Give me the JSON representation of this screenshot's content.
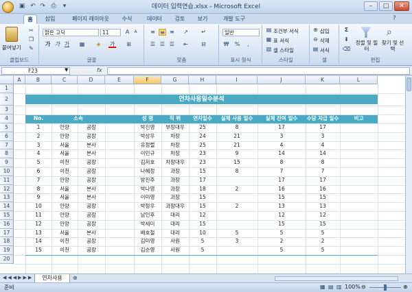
{
  "window": {
    "title": "데이터 입력연습.xlsx - Microsoft Excel"
  },
  "tabs": [
    "홈",
    "삽입",
    "페이지 레이아웃",
    "수식",
    "데이터",
    "검토",
    "보기",
    "개발 도구"
  ],
  "ribbon": {
    "clipboard": {
      "label": "클립보드",
      "paste": "붙여넣기"
    },
    "font": {
      "label": "글꼴",
      "name": "맑은 고딕",
      "size": "11"
    },
    "alignment": {
      "label": "맞춤"
    },
    "number": {
      "label": "표시 형식",
      "format": "일반"
    },
    "styles": {
      "label": "스타일",
      "conditional": "조건부 서식",
      "table": "표 서식",
      "cell": "셀 스타일"
    },
    "cells": {
      "label": "셀",
      "insert": "삽입",
      "delete": "삭제",
      "format": "서식"
    },
    "editing": {
      "label": "편집",
      "sort": "정렬 및 필터",
      "find": "찾기 및 선택"
    }
  },
  "formula_bar": {
    "name_box": "F23",
    "fx": "fx",
    "content": ""
  },
  "columns": [
    "A",
    "B",
    "C",
    "D",
    "E",
    "F",
    "G",
    "H",
    "I",
    "J",
    "K",
    "L"
  ],
  "selected_column": "F",
  "rows": [
    "1",
    "2",
    "3",
    "4",
    "5",
    "6",
    "7",
    "8",
    "9",
    "10",
    "11",
    "12",
    "13",
    "14",
    "15",
    "16",
    "17",
    "18",
    "19",
    "20"
  ],
  "sheet": {
    "title": "연차사용일수분석",
    "headers": [
      "No.",
      "소속",
      "성 명",
      "직 위",
      "연차일수",
      "실제 사용 일수",
      "실제 잔여 일수",
      "수당 지급 일수",
      "비고"
    ],
    "records": [
      [
        "1",
        "안양",
        "공장",
        "박진영",
        "부장대우",
        "25",
        "8",
        "17",
        "17",
        ""
      ],
      [
        "2",
        "안양",
        "공장",
        "박상우",
        "차장",
        "24",
        "21",
        "3",
        "3",
        ""
      ],
      [
        "3",
        "서울",
        "본사",
        "유정렬",
        "차장",
        "25",
        "21",
        "4",
        "4",
        ""
      ],
      [
        "4",
        "서울",
        "본사",
        "이민규",
        "차장",
        "23",
        "9",
        "14",
        "14",
        ""
      ],
      [
        "5",
        "이천",
        "공장",
        "김저호",
        "차장대우",
        "23",
        "15",
        "8",
        "8",
        ""
      ],
      [
        "6",
        "이천",
        "공장",
        "나혜정",
        "과장",
        "15",
        "8",
        "7",
        "7",
        ""
      ],
      [
        "7",
        "안양",
        "공장",
        "방진주",
        "과장",
        "17",
        "",
        "17",
        "17",
        ""
      ],
      [
        "8",
        "서울",
        "본사",
        "박나영",
        "과장",
        "18",
        "2",
        "16",
        "16",
        ""
      ],
      [
        "9",
        "서울",
        "본사",
        "이미영",
        "과장",
        "15",
        "",
        "15",
        "15",
        ""
      ],
      [
        "10",
        "안양",
        "공장",
        "박정우",
        "과장대우",
        "15",
        "2",
        "13",
        "13",
        ""
      ],
      [
        "11",
        "안양",
        "공장",
        "남인후",
        "대리",
        "12",
        "",
        "12",
        "12",
        ""
      ],
      [
        "12",
        "안양",
        "공장",
        "박세미",
        "대리",
        "15",
        "",
        "15",
        "15",
        ""
      ],
      [
        "13",
        "서울",
        "본사",
        "배호철",
        "대리",
        "10",
        "5",
        "5",
        "5",
        ""
      ],
      [
        "14",
        "이천",
        "공장",
        "김미영",
        "사원",
        "5",
        "3",
        "2",
        "2",
        ""
      ],
      [
        "15",
        "이천",
        "공장",
        "김순영",
        "사원",
        "5",
        "",
        "5",
        "5",
        ""
      ]
    ]
  },
  "sheet_tabs": {
    "active": "연차사용"
  },
  "status": {
    "ready": "준비",
    "zoom": "100%"
  }
}
